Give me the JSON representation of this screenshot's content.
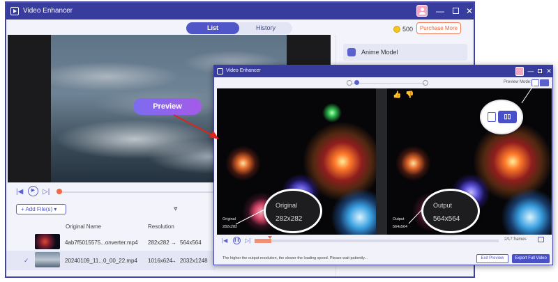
{
  "main_window": {
    "title": "Video Enhancer",
    "tabs": [
      {
        "label": "List",
        "active": true
      },
      {
        "label": "History",
        "active": false
      }
    ],
    "credits": "500",
    "purchase_label": "Purchase More",
    "preview_label": "Preview",
    "model_label": "Anime Model",
    "add_files_label": "+ Add File(s)  ▾",
    "table": {
      "headers": [
        "Original Name",
        "Resolution"
      ],
      "rows": [
        {
          "name": "4ab7f5015575...onverter.mp4",
          "res_in": "282x282",
          "arrow": "→",
          "res_out": "564x564",
          "selected": false
        },
        {
          "name": "20240109_11...0_00_22.mp4",
          "res_in": "1016x624",
          "arrow": "→",
          "res_out": "2032x1248",
          "selected": true
        }
      ]
    }
  },
  "preview_window": {
    "title": "Video Enhancer",
    "preview_mode_label": "Preview Mode:",
    "left_pane": {
      "label": "Original",
      "resolution": "282x282"
    },
    "right_pane": {
      "label": "Output",
      "resolution": "564x564"
    },
    "magnifier_pm_label": "▯▯",
    "frames": "2/17 frames",
    "hint": "The higher the output resolution, the slower the loading speed. Please wait patiently...",
    "exit_label": "Exit Preview",
    "export_label": "Export Full Video"
  },
  "colors": {
    "titlebar": "#383c9d",
    "accent": "#5b60cf",
    "purchase": "#ef7b5b",
    "callout_arrow": "#e2231a"
  },
  "icons": [
    "app-logo-icon",
    "user-icon",
    "minimize-icon",
    "maximize-icon",
    "close-icon",
    "coin-icon",
    "anime-model-icon",
    "prev-frame-icon",
    "play-icon",
    "next-frame-icon",
    "merge-icon",
    "check-icon",
    "thumbs-up-icon",
    "thumbs-down-icon",
    "zoom-out-icon",
    "zoom-in-icon",
    "single-view-icon",
    "split-view-icon",
    "screenshot-icon"
  ]
}
